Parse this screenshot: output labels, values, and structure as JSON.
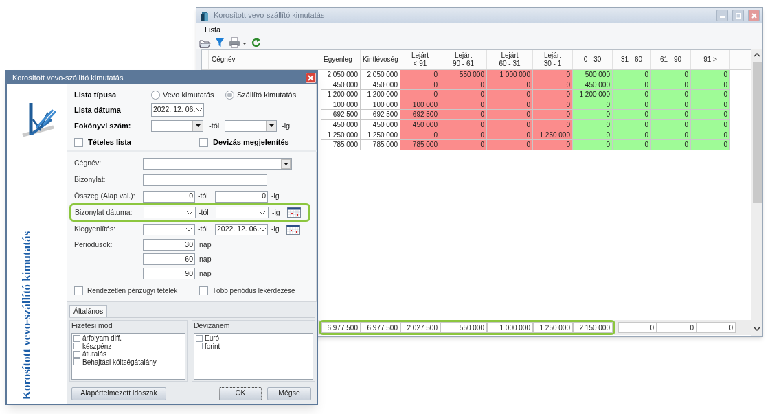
{
  "main_window": {
    "title": "Korosított vevo-szállító kimutatás",
    "menu": [
      "Lista"
    ],
    "table": {
      "columns": [
        {
          "lines": [
            "Cégnév"
          ],
          "kind": "name"
        },
        {
          "lines": [
            "Egyenleg"
          ],
          "kind": "amount"
        },
        {
          "lines": [
            "Kintlévoség"
          ],
          "kind": "amount"
        },
        {
          "lines": [
            "Lejárt",
            "< 91"
          ],
          "kind": "overdue"
        },
        {
          "lines": [
            "Lejárt",
            "90 - 61"
          ],
          "kind": "overdue"
        },
        {
          "lines": [
            "Lejárt",
            "60 - 31"
          ],
          "kind": "overdue"
        },
        {
          "lines": [
            "Lejárt",
            "30 - 1"
          ],
          "kind": "overdue"
        },
        {
          "lines": [
            "0 - 30"
          ],
          "kind": "current"
        },
        {
          "lines": [
            "31 - 60"
          ],
          "kind": "current"
        },
        {
          "lines": [
            "61 - 90"
          ],
          "kind": "current"
        },
        {
          "lines": [
            "91 >"
          ],
          "kind": "current"
        }
      ],
      "rows": [
        {
          "cells": [
            "",
            "2 050 000",
            "2 050 000",
            "0",
            "550 000",
            "1 000 000",
            "0",
            "500 000",
            "0",
            "0",
            "0"
          ]
        },
        {
          "cells": [
            "",
            "450 000",
            "450 000",
            "0",
            "0",
            "0",
            "0",
            "450 000",
            "0",
            "0",
            "0"
          ]
        },
        {
          "cells": [
            "",
            "1 200 000",
            "1 200 000",
            "0",
            "0",
            "0",
            "0",
            "1 200 000",
            "0",
            "0",
            "0"
          ]
        },
        {
          "cells": [
            "",
            "100 000",
            "100 000",
            "100 000",
            "0",
            "0",
            "0",
            "0",
            "0",
            "0",
            "0"
          ]
        },
        {
          "cells": [
            "",
            "692 500",
            "692 500",
            "692 500",
            "0",
            "0",
            "0",
            "0",
            "0",
            "0",
            "0"
          ]
        },
        {
          "cells": [
            "",
            "450 000",
            "450 000",
            "450 000",
            "0",
            "0",
            "0",
            "0",
            "0",
            "0",
            "0"
          ]
        },
        {
          "cells": [
            "",
            "1 250 000",
            "1 250 000",
            "0",
            "0",
            "0",
            "1 250 000",
            "0",
            "0",
            "0",
            "0"
          ]
        },
        {
          "cells": [
            "",
            "785 000",
            "785 000",
            "785 000",
            "0",
            "0",
            "0",
            "0",
            "0",
            "0",
            "0"
          ]
        }
      ],
      "totals": [
        {
          "highlighted": true,
          "cells": [
            "6 977 500",
            "6 977 500",
            "2 027 500",
            "550 000",
            "1 000 000",
            "1 250 000",
            "2 150 000"
          ]
        },
        {
          "highlighted": false,
          "cells": [
            "0",
            "0",
            "0"
          ]
        }
      ]
    }
  },
  "dialog": {
    "title": "Korosított vevo-szállító kimutatás",
    "side_title": "Korosított vevo-szállító kimutatás",
    "list_type": {
      "label": "Lista típusa",
      "options": [
        {
          "label": "Vevo kimutatás",
          "selected": false
        },
        {
          "label": "Szállító kimutatás",
          "selected": true
        }
      ]
    },
    "list_date": {
      "label": "Lista dátuma",
      "value": "2022. 12. 06."
    },
    "ledger": {
      "label": "Fokönyvi szám:",
      "from_suffix": "-tól",
      "to_suffix": "-ig"
    },
    "top_checks": [
      {
        "label": "Tételes lista",
        "checked": false
      },
      {
        "label": "Devizás megjelenítés",
        "checked": false
      }
    ],
    "filters": [
      {
        "kind": "combo",
        "label": "Cégnév:",
        "highlighted": false
      },
      {
        "kind": "text",
        "label": "Bizonylat:",
        "highlighted": false
      },
      {
        "kind": "number_range",
        "label": "Összeg (Alap val.):",
        "from": "0",
        "from_suffix": "-tól",
        "to": "0",
        "to_suffix": "-ig",
        "highlighted": false
      },
      {
        "kind": "date_range",
        "label": "Bizonylat dátuma:",
        "from_suffix": "-tól",
        "to_suffix": "-ig",
        "highlighted": true
      },
      {
        "kind": "date_range",
        "label": "Kiegyenlítés:",
        "from_suffix": "-tól",
        "to": "2022. 12. 06.",
        "to_suffix": "-ig",
        "highlighted": false
      }
    ],
    "periods": {
      "label": "Periódusok:",
      "values": [
        {
          "value": "30",
          "unit": "nap"
        },
        {
          "value": "60",
          "unit": "nap"
        },
        {
          "value": "90",
          "unit": "nap"
        }
      ]
    },
    "bottom_checks": [
      {
        "label": "Rendezetlen pénzügyi tételek",
        "checked": false
      },
      {
        "label": "Több periódus lekérdezése",
        "checked": false
      }
    ],
    "tabs": [
      {
        "label": "Általános",
        "selected": true
      }
    ],
    "groups": [
      {
        "title": "Fizetési mód",
        "items": [
          {
            "label": "árfolyam diff.",
            "checked": false
          },
          {
            "label": "készpénz",
            "checked": false
          },
          {
            "label": "átutalás",
            "checked": false
          },
          {
            "label": "Behajtási költségátalány",
            "checked": false
          }
        ]
      },
      {
        "title": "Devizanem",
        "items": [
          {
            "label": "Euró",
            "checked": false
          },
          {
            "label": "forint",
            "checked": false
          }
        ]
      }
    ],
    "buttons": [
      {
        "label": "Alapértelmezett idoszak",
        "default": false
      },
      {
        "label": "OK",
        "default": true
      },
      {
        "label": "Mégse",
        "default": false
      }
    ]
  }
}
